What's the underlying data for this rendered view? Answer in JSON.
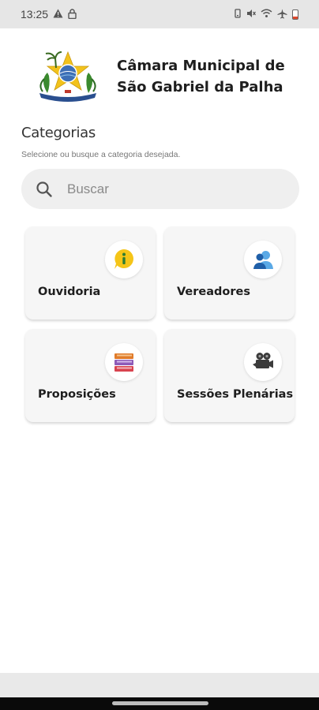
{
  "status_bar": {
    "time": "13:25",
    "left_icons": [
      "warning-icon",
      "lock-icon"
    ],
    "right_icons": [
      "vibrate-icon",
      "mute-icon",
      "wifi-icon",
      "airplane-icon",
      "battery-icon"
    ]
  },
  "header": {
    "logo": "municipal-coat-of-arms",
    "title": "Câmara Municipal de São Gabriel da Palha"
  },
  "categories": {
    "title": "Categorias",
    "subtitle": "Selecione ou busque a categoria desejada."
  },
  "search": {
    "placeholder": "Buscar",
    "icon": "search-icon"
  },
  "cards": [
    {
      "label": "Ouvidoria",
      "icon": "info-bubble-icon"
    },
    {
      "label": "Vereadores",
      "icon": "people-icon"
    },
    {
      "label": "Proposições",
      "icon": "books-icon"
    },
    {
      "label": "Sessões Plenárias",
      "icon": "video-camera-icon"
    }
  ],
  "colors": {
    "background": "#ffffff",
    "card": "#f6f6f6",
    "search_bg": "#efefef",
    "status_bar": "#e6e6e6",
    "text": "#1e1e1e"
  }
}
